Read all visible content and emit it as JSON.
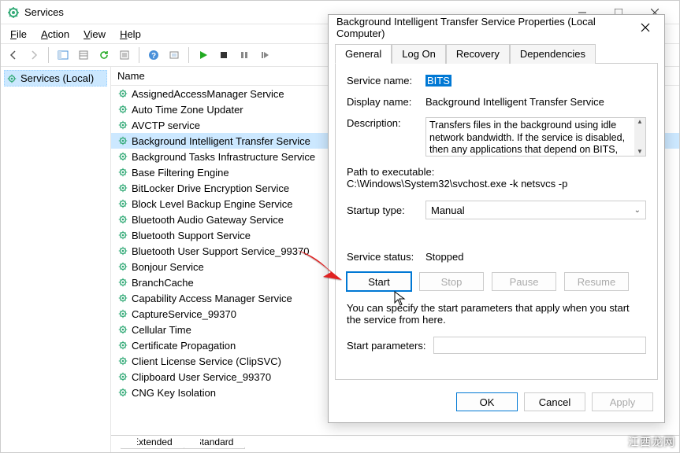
{
  "window": {
    "title": "Services",
    "menus": [
      "File",
      "Action",
      "View",
      "Help"
    ],
    "nav_item": "Services (Local)",
    "column_header": "Name",
    "services": [
      "AssignedAccessManager Service",
      "Auto Time Zone Updater",
      "AVCTP service",
      "Background Intelligent Transfer Service",
      "Background Tasks Infrastructure Service",
      "Base Filtering Engine",
      "BitLocker Drive Encryption Service",
      "Block Level Backup Engine Service",
      "Bluetooth Audio Gateway Service",
      "Bluetooth Support Service",
      "Bluetooth User Support Service_99370",
      "Bonjour Service",
      "BranchCache",
      "Capability Access Manager Service",
      "CaptureService_99370",
      "Cellular Time",
      "Certificate Propagation",
      "Client License Service (ClipSVC)",
      "Clipboard User Service_99370",
      "CNG Key Isolation"
    ],
    "selected_index": 3,
    "bottom_tabs": {
      "extended": "Extended",
      "standard": "Standard"
    }
  },
  "dialog": {
    "title": "Background Intelligent Transfer Service Properties (Local Computer)",
    "tabs": {
      "general": "General",
      "logon": "Log On",
      "recovery": "Recovery",
      "dependencies": "Dependencies"
    },
    "labels": {
      "service_name": "Service name:",
      "display_name": "Display name:",
      "description": "Description:",
      "path": "Path to executable:",
      "startup_type": "Startup type:",
      "service_status": "Service status:",
      "hint": "You can specify the start parameters that apply when you start the service from here.",
      "start_params": "Start parameters:"
    },
    "values": {
      "service_name": "BITS",
      "display_name": "Background Intelligent Transfer Service",
      "description": "Transfers files in the background using idle network bandwidth. If the service is disabled, then any applications that depend on BITS, such as Windows",
      "path": "C:\\Windows\\System32\\svchost.exe -k netsvcs -p",
      "startup_type": "Manual",
      "service_status": "Stopped"
    },
    "buttons": {
      "start": "Start",
      "stop": "Stop",
      "pause": "Pause",
      "resume": "Resume",
      "ok": "OK",
      "cancel": "Cancel",
      "apply": "Apply"
    }
  },
  "watermark": "江西龙网"
}
